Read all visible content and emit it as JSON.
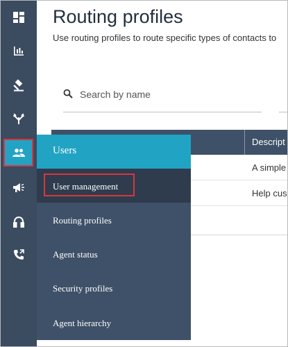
{
  "page": {
    "title": "Routing profiles",
    "subtitle": "Use routing profiles to route specific types of contacts to"
  },
  "search": {
    "placeholder": "Search by name"
  },
  "table": {
    "header_description": "Descript",
    "rows": [
      {
        "description": "A simple"
      },
      {
        "description": "Help cus"
      }
    ]
  },
  "rail": {
    "icons": [
      "dashboard-icon",
      "metrics-icon",
      "routing-icon",
      "flows-icon",
      "users-icon",
      "channels-icon",
      "headset-icon",
      "phone-icon"
    ],
    "active": "users-icon",
    "colors": {
      "background": "#3b4b60",
      "active": "#22a3c4",
      "highlight_border": "#d9363e"
    }
  },
  "flyout": {
    "header": "Users",
    "items": [
      {
        "label": "User management",
        "highlighted": true
      },
      {
        "label": "Routing profiles"
      },
      {
        "label": "Agent status"
      },
      {
        "label": "Security profiles"
      },
      {
        "label": "Agent hierarchy"
      }
    ]
  }
}
